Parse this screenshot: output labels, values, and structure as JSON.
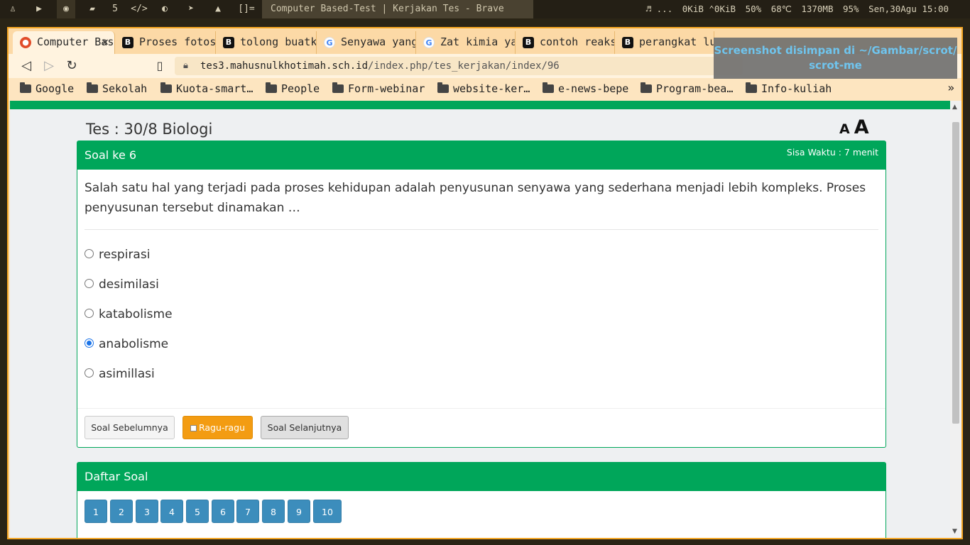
{
  "system_bar": {
    "workspaces": [
      "5",
      "</>",
      "[]="
    ],
    "window_title": "Computer Based-Test | Kerjakan Tes - Brave",
    "status": {
      "media": "♬ ...",
      "network": "0KiB ⌃0KiB",
      "cpu": "50%",
      "temp": "68℃",
      "memory": "1370MB",
      "volume": "95%",
      "datetime": "Sen,30Agu 15:00"
    }
  },
  "browser": {
    "tabs": [
      {
        "label": "Computer Based-Test",
        "icon": "brave-icon"
      },
      {
        "label": "Proses fotosintesis",
        "icon": "brainly-icon"
      },
      {
        "label": "tolong buatkan",
        "icon": "brainly-icon"
      },
      {
        "label": "Senyawa yang",
        "icon": "google-icon"
      },
      {
        "label": "Zat kimia yang",
        "icon": "google-icon"
      },
      {
        "label": "contoh reaksi",
        "icon": "brainly-icon"
      },
      {
        "label": "perangkat lunak",
        "icon": "brainly-icon"
      }
    ],
    "url": {
      "host": "tes3.mahusnulkhotimah.sch.id",
      "path": "/index.php/tes_kerjakan/index/96"
    },
    "bookmarks": [
      "Google",
      "Sekolah",
      "Kuota-smart…",
      "People",
      "Form-webinar",
      "website-ker…",
      "e-news-bepe",
      "Program-bea…",
      "Info-kuliah"
    ],
    "bookmarks_more": "»"
  },
  "page": {
    "test_title": "Tes : 30/8 Biologi",
    "font_small": "A",
    "font_large": "A",
    "question": {
      "heading": "Soal ke 6",
      "timer": "Sisa Waktu : 7 menit",
      "text": "Salah satu hal yang terjadi pada proses kehidupan adalah penyusunan senyawa yang sederhana menjadi lebih kompleks. Proses penyusunan tersebut dinamakan …",
      "options": [
        {
          "label": "respirasi",
          "checked": false
        },
        {
          "label": "desimilasi",
          "checked": false
        },
        {
          "label": "katabolisme",
          "checked": false
        },
        {
          "label": "anabolisme",
          "checked": true
        },
        {
          "label": "asimillasi",
          "checked": false
        }
      ],
      "prev_label": "Soal Sebelumnya",
      "doubt_label": "Ragu-ragu",
      "next_label": "Soal Selanjutnya"
    },
    "question_list": {
      "heading": "Daftar Soal",
      "numbers": [
        "1",
        "2",
        "3",
        "4",
        "5",
        "6",
        "7",
        "8",
        "9",
        "10"
      ]
    }
  },
  "notification": {
    "line1": "Screenshot disimpan di ~/Gambar/scrot/",
    "line2": "scrot-me"
  }
}
